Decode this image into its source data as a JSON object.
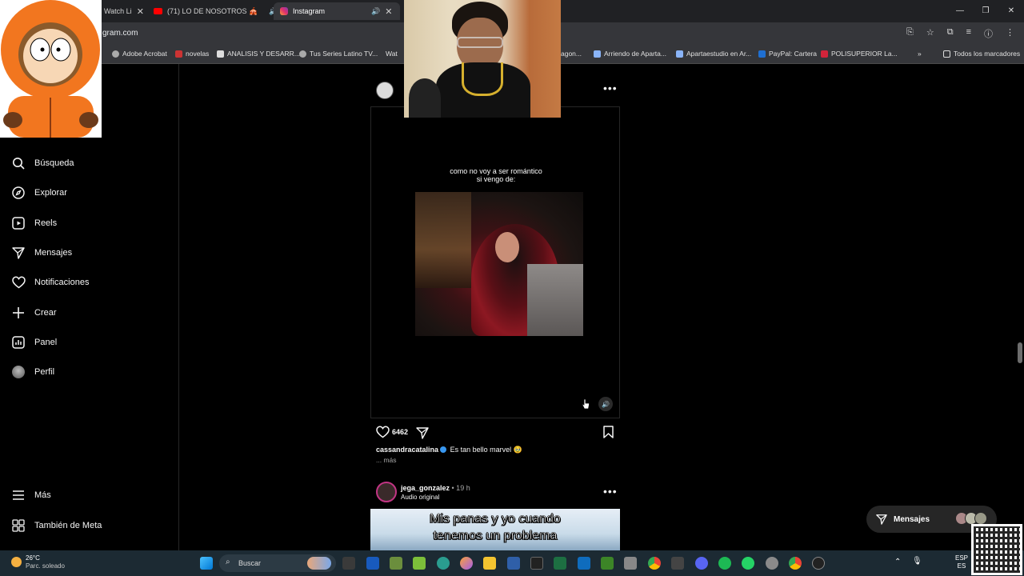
{
  "browser": {
    "tabs": [
      {
        "label": "Watch Li"
      },
      {
        "label": "(71) LO DE NOSOTROS 🎪"
      },
      {
        "label": "Instagram"
      }
    ],
    "url": "gram.com",
    "bookmarks": [
      {
        "label": "Adobe Acrobat"
      },
      {
        "label": "novelas"
      },
      {
        "label": "ANALISIS Y DESARR..."
      },
      {
        "label": "Tus Series Latino TV..."
      },
      {
        "label": "Wat"
      },
      {
        "label": "agon..."
      },
      {
        "label": "Arriendo de Aparta..."
      },
      {
        "label": "Apartaestudio en Ar..."
      },
      {
        "label": "PayPal: Cartera"
      },
      {
        "label": "POLISUPERIOR La..."
      },
      {
        "label": "Todos los marcadores"
      }
    ]
  },
  "sidebar": {
    "items": [
      {
        "label": "Búsqueda",
        "icon": "search-icon"
      },
      {
        "label": "Explorar",
        "icon": "compass-icon"
      },
      {
        "label": "Reels",
        "icon": "reels-icon"
      },
      {
        "label": "Mensajes",
        "icon": "send-icon"
      },
      {
        "label": "Notificaciones",
        "icon": "heart-icon"
      },
      {
        "label": "Crear",
        "icon": "plus-icon"
      },
      {
        "label": "Panel",
        "icon": "chart-icon"
      },
      {
        "label": "Perfil",
        "icon": "avatar"
      }
    ],
    "bottom": [
      {
        "label": "Más",
        "icon": "menu-icon"
      },
      {
        "label": "También de Meta",
        "icon": "meta-icon"
      }
    ]
  },
  "post1": {
    "overlay_text_line1": "como no voy a ser romántico",
    "overlay_text_line2": "si vengo de:",
    "likes": "6462",
    "username": "cassandracatalina",
    "caption": "Es tan bello marvel 🥹",
    "more": "... más"
  },
  "post2": {
    "username": "jega_gonzalez",
    "time": " • 19 h",
    "audio": "Audio original",
    "meme_line1": "Mis panas y yo cuando",
    "meme_line2": "tenemos un problema"
  },
  "messages_pill": {
    "label": "Mensajes"
  },
  "taskbar": {
    "temperature": "26°C",
    "weather": "Parc. soleado",
    "search_placeholder": "Buscar",
    "lang_top": "ESP",
    "lang_bottom": "ES"
  },
  "colors": {
    "background": "#000000",
    "verified": "#3897f0",
    "chrome_bar": "#202124",
    "taskbar": "#1c2a33"
  }
}
